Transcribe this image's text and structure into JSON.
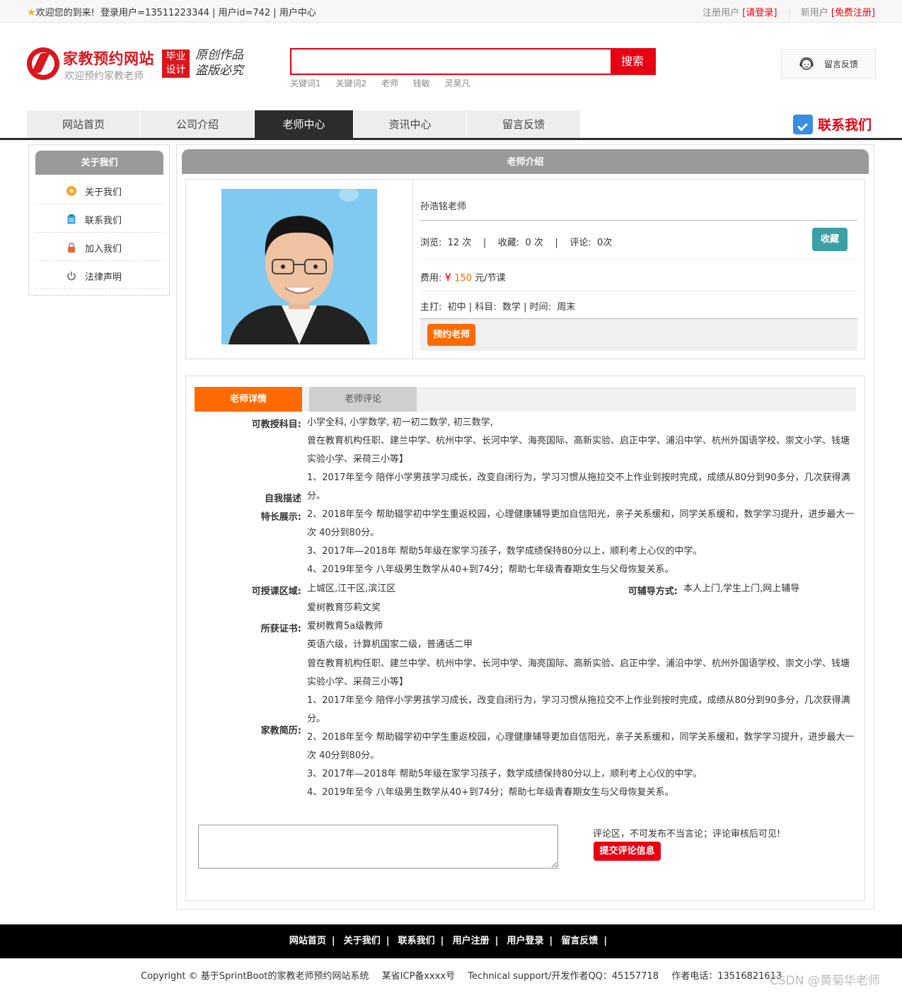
{
  "topbar": {
    "welcome": "欢迎您的到来!",
    "login_user": "登录用户=13511223344",
    "user_id": "用户id=742",
    "user_center": "用户中心",
    "registered_label": "注册用户",
    "login_link": "[请登录]",
    "new_user_label": "新用户",
    "register_link": "[免费注册]"
  },
  "header": {
    "logo_name": "家教预约网站",
    "logo_sub": "欢迎预约家教老师",
    "badge_line1": "毕业",
    "badge_line2": "设计",
    "slogan_line1": "原创作品",
    "slogan_line2": "盗版必究",
    "search_placeholder": "",
    "search_button": "搜索",
    "hot_keywords": [
      "关键词1",
      "关键词2",
      "老师",
      "钱敏",
      "灵昊凡"
    ],
    "feedback_label": "留言反馈"
  },
  "nav": {
    "items": [
      {
        "label": "网站首页",
        "active": false
      },
      {
        "label": "公司介绍",
        "active": false
      },
      {
        "label": "老师中心",
        "active": true
      },
      {
        "label": "资讯中心",
        "active": false
      },
      {
        "label": "留言反馈",
        "active": false
      }
    ],
    "contact_label": "联系我们"
  },
  "sidebar": {
    "title": "关于我们",
    "items": [
      {
        "label": "关于我们",
        "icon": "orange-circle-icon"
      },
      {
        "label": "联系我们",
        "icon": "clipboard-icon"
      },
      {
        "label": "加入我们",
        "icon": "lock-icon"
      },
      {
        "label": "法律声明",
        "icon": "power-icon"
      }
    ]
  },
  "main": {
    "title": "老师介绍",
    "teacher_name": "孙浩铭老师",
    "stats": {
      "views_label": "浏览:",
      "views_value": "12 次",
      "favorites_label": "收藏:",
      "favorites_value": "0 次",
      "comments_label": "评论:",
      "comments_value": "0次"
    },
    "favorite_button": "收藏",
    "fee_label": "费用:",
    "fee_currency": "¥",
    "fee_value": "150",
    "fee_unit": "元/节课",
    "major_label": "主打:",
    "major_value": "初中",
    "subject_label": "科目:",
    "subject_value": "数学",
    "time_label": "时间:",
    "time_value": "周末",
    "book_button": "预约老师"
  },
  "tabs": [
    {
      "label": "老师详情",
      "active": true
    },
    {
      "label": "老师评论",
      "active": false
    }
  ],
  "details": {
    "subjects_label": "可教授科目:",
    "subjects_value": "小学全科, 小学数学, 初一初二数学, 初三数学,",
    "self_desc_label": "自我描述",
    "self_desc_lines": [
      "曾在教育机构任职、建兰中学、杭州中学、长河中学、海亮国际、高新实验、启正中学、浦沿中学、杭州外国语学校、崇文小学、钱塘实验小学、采荷三小等】",
      "1、2017年至今 陪伴小学男孩学习成长，改变自闭行为，学习习惯从拖拉交不上作业到按时完成，成绩从80分到90多分，几次获得满分。",
      "2、2018年至今 帮助辍学初中学生重返校园，心理健康辅导更加自信阳光，亲子关系缓和，同学关系缓和，数学学习提升，进步最大一次 40分到80分。",
      "3、2017年—2018年 帮助5年级在家学习孩子，数学成绩保持80分以上，顺利考上心仪的中学。",
      "4、2019年至今 八年级男生数学从40+到74分；帮助七年级青春期女生与父母恢复关系。"
    ],
    "specialty_label": "特长展示:",
    "area_label": "可授课区域:",
    "area_value": "上城区,江干区,滨江区",
    "mode_label": "可辅导方式:",
    "mode_value": "本人上门,学生上门,网上辅导",
    "certs_label": "所获证书:",
    "certs_lines": [
      "爱树教育莎莉文奖",
      "爱树教育5a级教师",
      "英语六级，计算机国家二级，普通话二甲"
    ],
    "history_label": "家教简历:",
    "history_lines": [
      "曾在教育机构任职、建兰中学、杭州中学、长河中学、海亮国际、高新实验、启正中学、浦沿中学、杭州外国语学校、崇文小学、钱塘实验小学、采荷三小等】",
      "1、2017年至今 陪伴小学男孩学习成长，改变自闭行为，学习习惯从拖拉交不上作业到按时完成，成绩从80分到90多分，几次获得满分。",
      "2、2018年至今 帮助辍学初中学生重返校园，心理健康辅导更加自信阳光，亲子关系缓和，同学关系缓和，数学学习提升，进步最大一次 40分到80分。",
      "3、2017年—2018年 帮助5年级在家学习孩子，数学成绩保持80分以上，顺利考上心仪的中学。",
      "4、2019年至今 八年级男生数学从40+到74分；帮助七年级青春期女生与父母恢复关系。"
    ]
  },
  "comment": {
    "tip": "评论区，不可发布不当言论；评论审核后可见!",
    "submit_button": "提交评论信息"
  },
  "footer": {
    "links": [
      "网站首页",
      "关于我们",
      "联系我们",
      "用户注册",
      "用户登录",
      "留言反馈"
    ],
    "separator": "|",
    "copyright": "Copyright © 基于SprintBoot的家教老师预约网站系统",
    "icp": "某省ICP备xxxx号",
    "support": "Technical support/开发作者QQ：45157718",
    "phone": "作者电话：13516821613",
    "watermark": "CSDN @黄菊华老师"
  },
  "colors": {
    "brand_red": "#e60012",
    "orange": "#ff6a00",
    "teal": "#3aa0a3",
    "nav_dark": "#2d2d2d",
    "panel_grey": "#9a9a9a"
  }
}
